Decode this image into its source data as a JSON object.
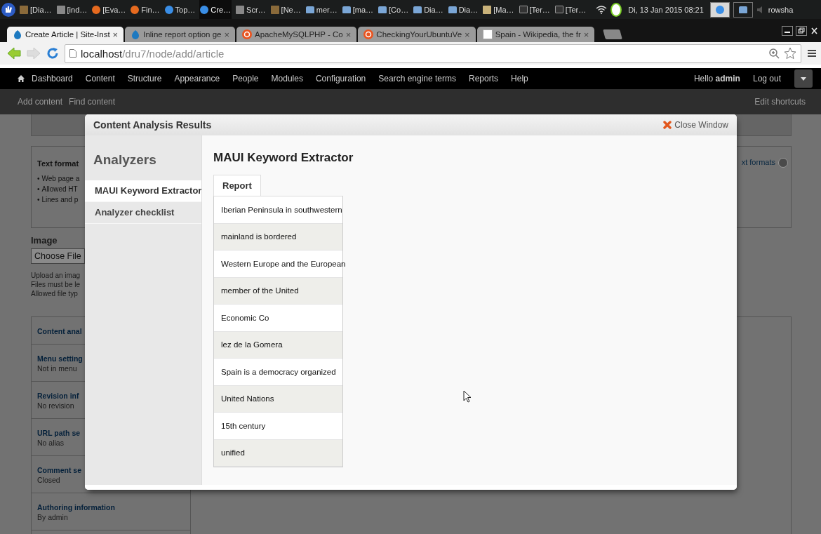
{
  "taskbar": {
    "items": [
      {
        "label": "[Dia…",
        "kind": "app",
        "selected": false
      },
      {
        "label": "[ind…",
        "kind": "window",
        "selected": false
      },
      {
        "label": "[Eva…",
        "kind": "firefox",
        "selected": false
      },
      {
        "label": "Fin…",
        "kind": "firefox",
        "selected": false
      },
      {
        "label": "Top…",
        "kind": "chrome",
        "selected": false
      },
      {
        "label": "Cre…",
        "kind": "chrome",
        "selected": true
      },
      {
        "label": "Scr…",
        "kind": "window",
        "selected": false
      },
      {
        "label": "[Ne…",
        "kind": "app",
        "selected": false
      },
      {
        "label": "mer…",
        "kind": "folder",
        "selected": false
      },
      {
        "label": "[ma…",
        "kind": "folder",
        "selected": false
      },
      {
        "label": "[Co…",
        "kind": "folder",
        "selected": false
      },
      {
        "label": "Dia…",
        "kind": "folder",
        "selected": false
      },
      {
        "label": "Dia…",
        "kind": "folder",
        "selected": false
      },
      {
        "label": "[Ma…",
        "kind": "editor",
        "selected": false
      },
      {
        "label": "[Ter…",
        "kind": "terminal",
        "selected": false
      },
      {
        "label": "[Ter…",
        "kind": "terminal",
        "selected": false
      }
    ],
    "clock": "Di, 13 Jan 2015 08:21",
    "user": "rowsha"
  },
  "browser": {
    "tabs": [
      {
        "label": "Create Article | Site-Inst",
        "kind": "drupal",
        "selected": true,
        "close": "×"
      },
      {
        "label": "Inline report option ge",
        "kind": "drupal",
        "selected": false,
        "close": "×"
      },
      {
        "label": "ApacheMySQLPHP - Co",
        "kind": "ubuntu",
        "selected": false,
        "close": "×"
      },
      {
        "label": "CheckingYourUbuntuVe",
        "kind": "ubuntu",
        "selected": false,
        "close": "×"
      },
      {
        "label": "Spain - Wikipedia, the fr",
        "kind": "wikipedia",
        "selected": false,
        "close": "×"
      }
    ],
    "address": {
      "host": "localhost",
      "path": "/dru7/node/add/article"
    }
  },
  "admin_menu": {
    "items": [
      "Dashboard",
      "Content",
      "Structure",
      "Appearance",
      "People",
      "Modules",
      "Configuration",
      "Search engine terms",
      "Reports",
      "Help"
    ],
    "greeting": "Hello **admin**",
    "logout": "Log out"
  },
  "shortcuts": {
    "items": [
      "Add content",
      "Find content"
    ],
    "edit": "Edit shortcuts"
  },
  "page": {
    "text_format": {
      "label": "Text format",
      "tips": [
        {
          "bullet": "•",
          "text": "Web page a"
        },
        {
          "bullet": "•",
          "text": "Allowed HT"
        },
        {
          "bullet": "•",
          "text": "Lines and p"
        }
      ],
      "link": "xt formats"
    },
    "image": {
      "label": "Image",
      "button": "Choose File",
      "help": [
        "Upload an imag",
        "Files must be le",
        "Allowed file typ"
      ]
    },
    "vertical_tabs": [
      {
        "title": "Content anal"
      },
      {
        "title": "Menu setting",
        "summary": "Not in menu"
      },
      {
        "title": "Revision inf",
        "summary": "No revision"
      },
      {
        "title": "URL path se",
        "summary": "No alias"
      },
      {
        "title": "Comment se",
        "summary": "Closed"
      },
      {
        "title": "Authoring information",
        "summary": "By admin"
      }
    ]
  },
  "modal": {
    "title": "Content Analysis Results",
    "close": "Close Window",
    "sidebar": {
      "heading": "Analyzers",
      "items": [
        {
          "label": "MAUI Keyword Extractor",
          "selected": true
        },
        {
          "label": "Analyzer checklist",
          "selected": false
        }
      ]
    },
    "main": {
      "heading": "MAUI Keyword Extractor",
      "tabs": [
        {
          "label": "Report",
          "selected": true
        }
      ],
      "rows": [
        "Iberian Peninsula in southwestern",
        "mainland is bordered",
        "Western Europe and the European",
        "member of the United",
        "Economic Co",
        "lez de la Gomera",
        "Spain is a democracy organized",
        "United Nations",
        "15th century",
        "unified"
      ]
    }
  }
}
